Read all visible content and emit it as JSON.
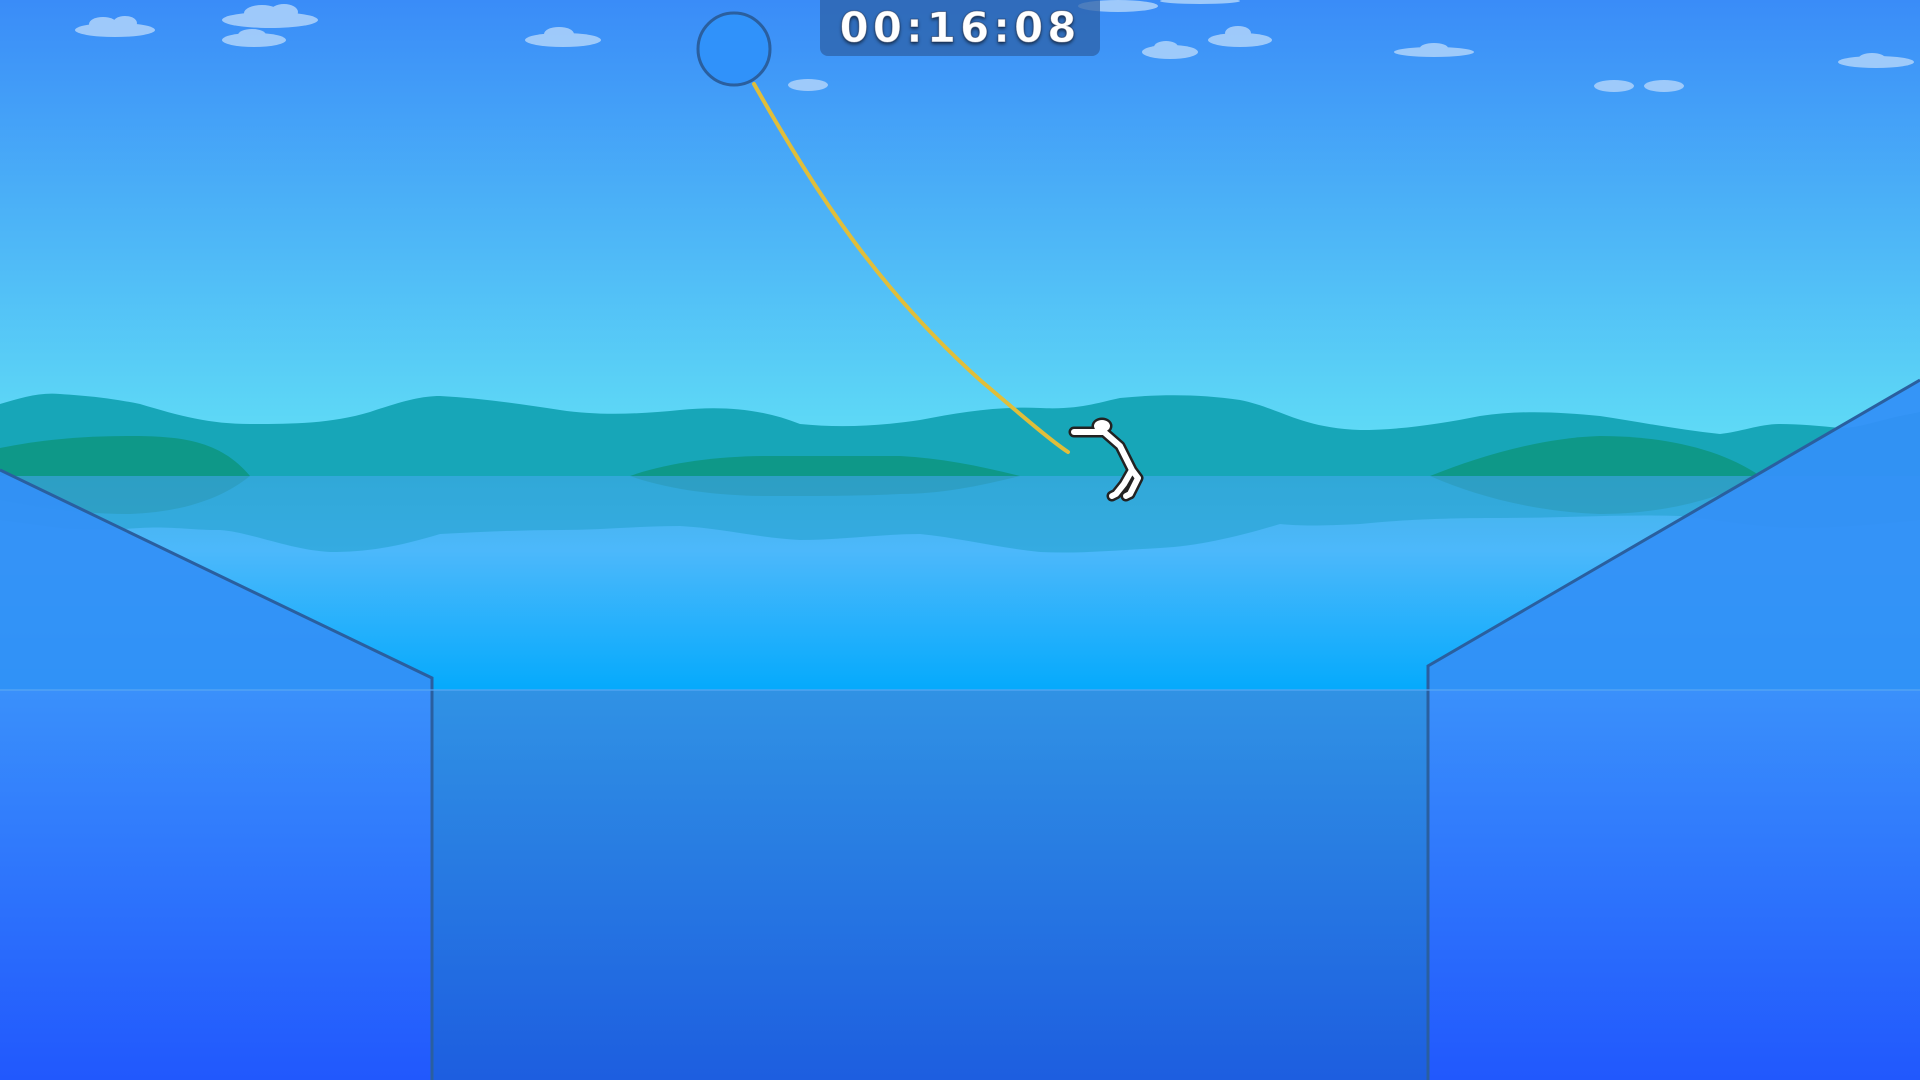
{
  "hud": {
    "timer": "00:16:08"
  },
  "colors": {
    "sky_top": "#3a8cf8",
    "sky_bottom": "#62e2f6",
    "far_hills": "#17a6b8",
    "near_hills": "#0e9888",
    "lake_top": "#43b2e6",
    "lake_bottom": "#05aafc",
    "ramp": "#2f8cf4",
    "ramp_edge": "#2a5f9f",
    "pit": "#2b86e0",
    "rope": "#e0be3a",
    "anchor": "#3092fa",
    "player": "#ffffff"
  }
}
